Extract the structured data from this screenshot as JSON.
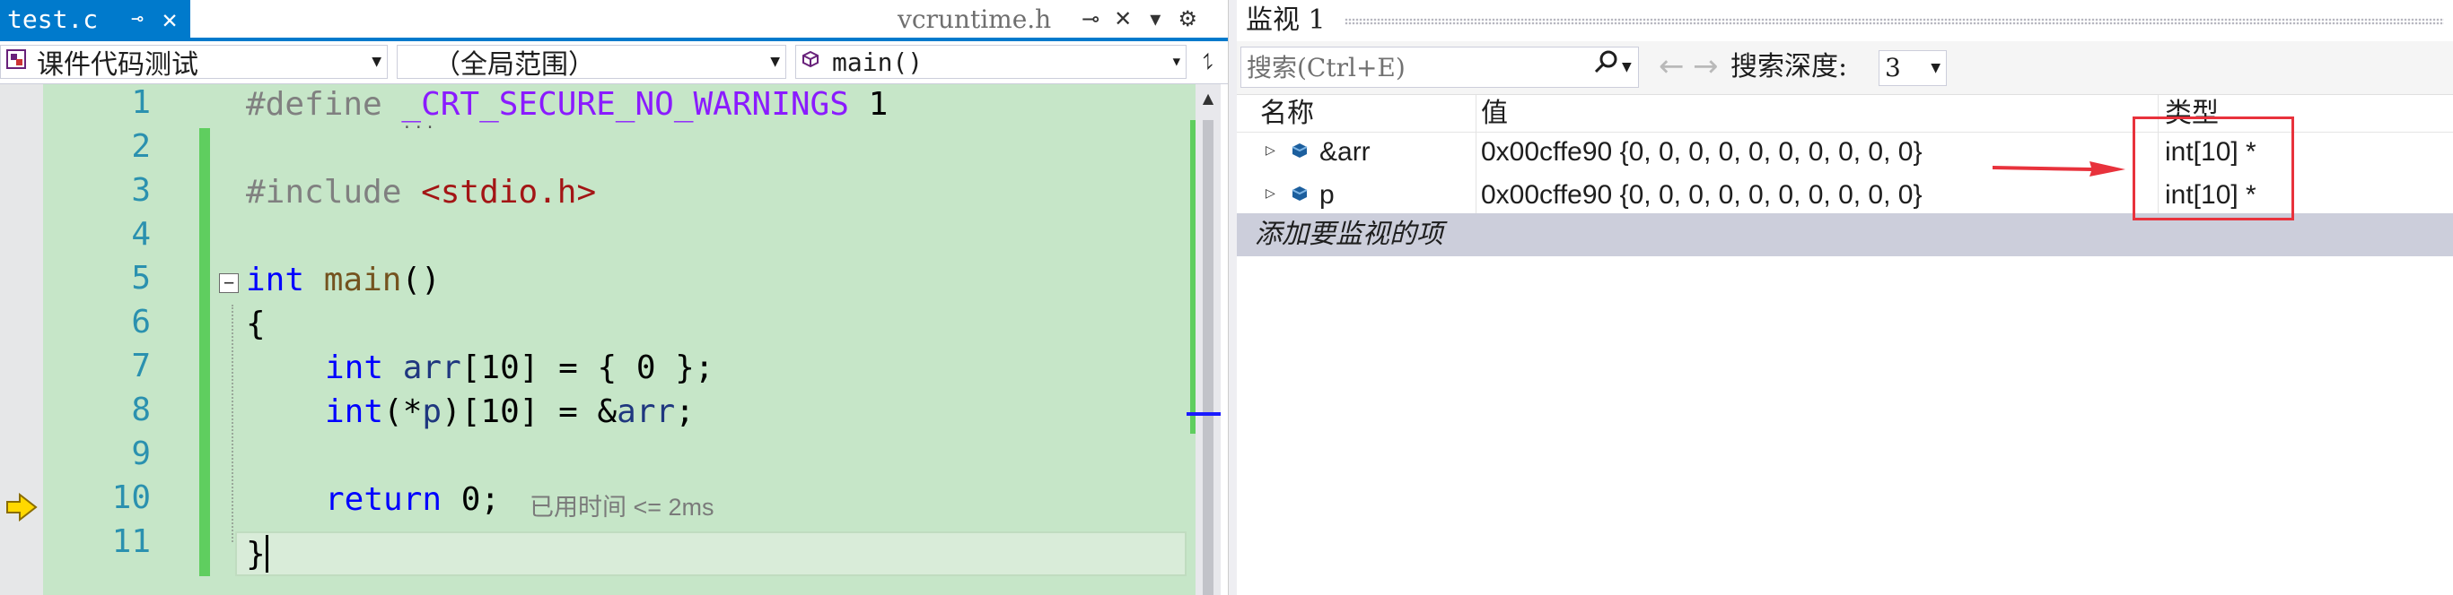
{
  "editor": {
    "active_tab": {
      "name": "test.c",
      "pin_glyph": "⊸",
      "close_glyph": "✕"
    },
    "preview_tab": {
      "name": "vcruntime.h",
      "keep_open_glyph": "⊸",
      "close_glyph": "✕",
      "menu_glyph": "▾",
      "settings_glyph": "⚙"
    },
    "nav": {
      "project": "课件代码测试",
      "scope": "（全局范围）",
      "member": "main()",
      "split_glyph": "⥍"
    },
    "line_numbers": [
      "1",
      "2",
      "3",
      "4",
      "5",
      "6",
      "7",
      "8",
      "9",
      "10",
      "11"
    ],
    "code": {
      "l1_pre": "#define ",
      "l1_macro": "_CRT_SECURE_NO_WARNINGS",
      "l1_val": " 1",
      "l3_pre": "#include ",
      "l3_str": "<stdio.h>",
      "l5_kw": "int",
      "l5_fn": "main",
      "l5_rest": "()",
      "l6": "{",
      "l7_kw": "int",
      "l7_var": "arr",
      "l7_rest": "[10] = { 0 };",
      "l8_kw": "int",
      "l8_a": "(*",
      "l8_var": "p",
      "l8_b": ")[10] = &",
      "l8_var2": "arr",
      "l8_c": ";",
      "l10_kw": "return",
      "l10_rest": " 0;",
      "l11": "}"
    },
    "perf_tip": "已用时间 <= 2ms",
    "collapse_glyph": "−"
  },
  "watch": {
    "title": "监视 1",
    "search_placeholder": "搜索(Ctrl+E)",
    "search_glyph": "⚲",
    "back_glyph": "←",
    "forward_glyph": "→",
    "depth_label": "搜索深度:",
    "depth_value": "3",
    "columns": {
      "name": "名称",
      "value": "值",
      "type": "类型"
    },
    "rows": [
      {
        "name": "&arr",
        "value": "0x00cffe90 {0, 0, 0, 0, 0, 0, 0, 0, 0, 0}",
        "type": "int[10] *"
      },
      {
        "name": "p",
        "value": "0x00cffe90 {0, 0, 0, 0, 0, 0, 0, 0, 0, 0}",
        "type": "int[10] *"
      }
    ],
    "add_item": "添加要监视的项"
  },
  "colors": {
    "accent": "#007acc",
    "code_bg": "#c6e6c8",
    "annotation": "#e8323c"
  }
}
